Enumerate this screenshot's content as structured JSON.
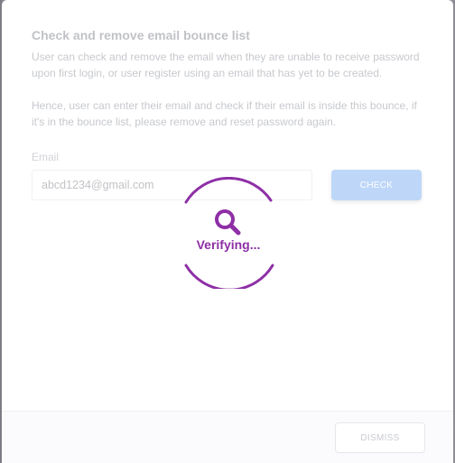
{
  "modal": {
    "title": "Check and remove email bounce list",
    "description_1": "User can check and remove the email when they are unable to receive password upon first login, or user register using an email that has yet to be created.",
    "description_2": "Hence, user can enter their email and check if their email is inside this bounce, if it's in the bounce list, please remove and reset password again.",
    "email_label": "Email",
    "email_value": "abcd1234@gmail.com",
    "check_label": "CHECK",
    "dismiss_label": "DISMISS"
  },
  "loader": {
    "text": "Verifying...",
    "color": "#8e2fa6",
    "icon": "search-icon"
  },
  "colors": {
    "check_button": "#1a73e8",
    "backdrop": "#9a9aa2"
  }
}
